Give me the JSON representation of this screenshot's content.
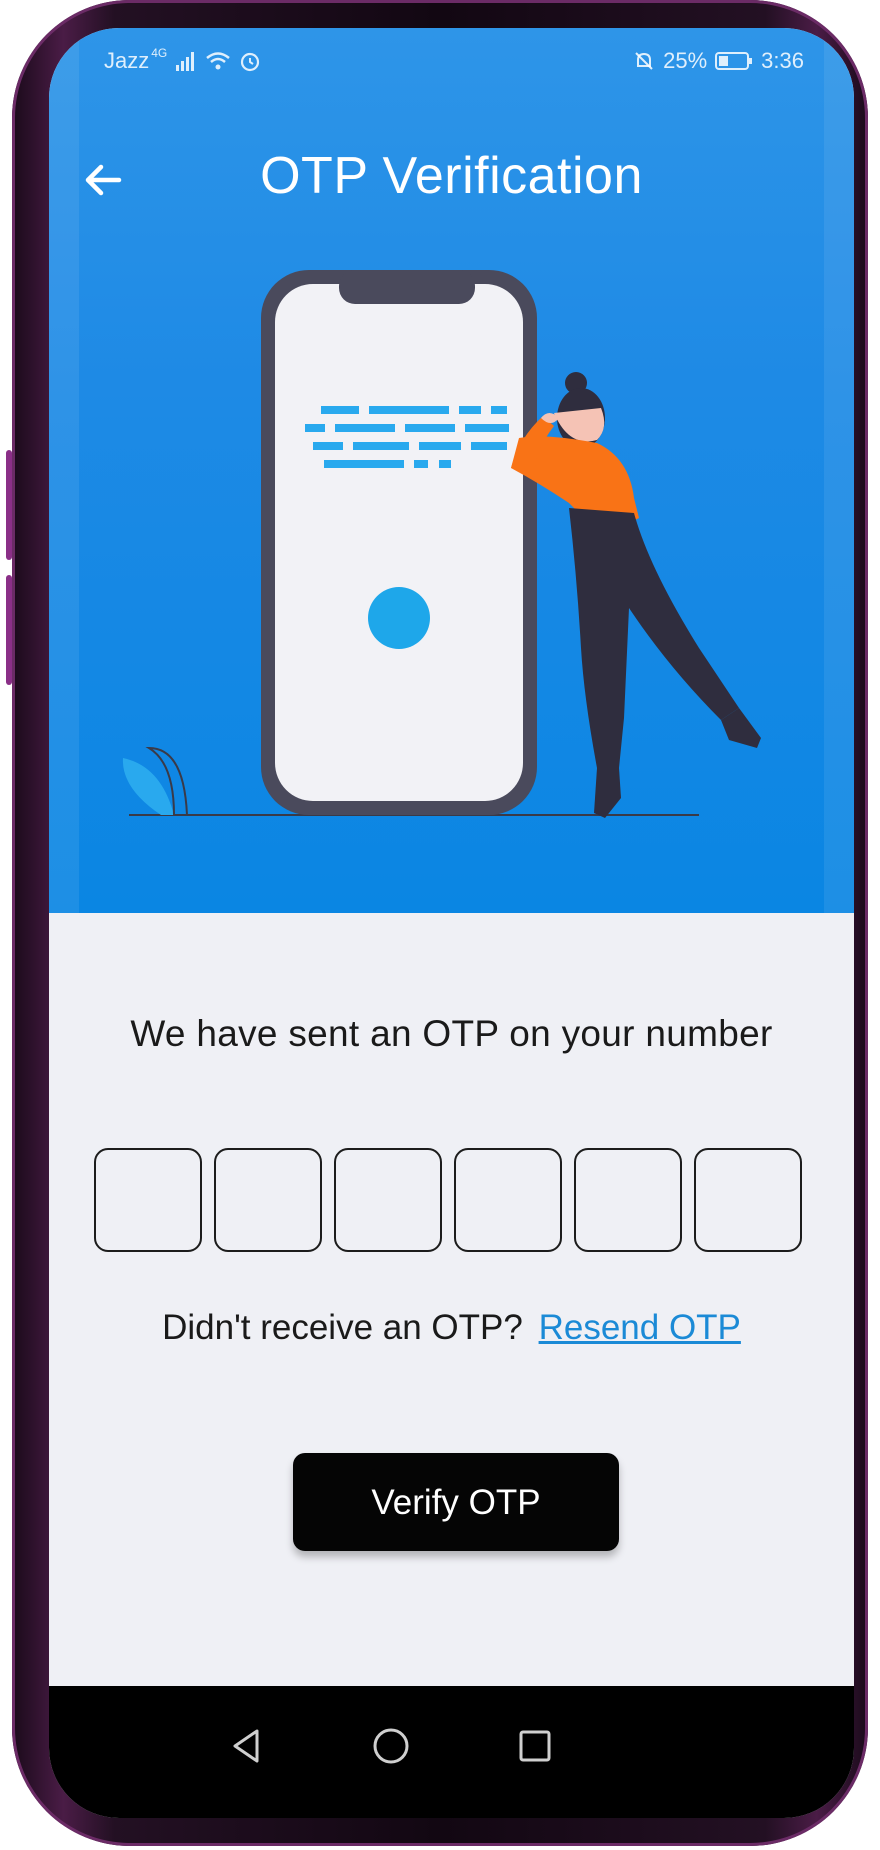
{
  "status_bar": {
    "carrier": "Jazz",
    "network": "4G",
    "battery": "25%",
    "time": "3:36"
  },
  "header": {
    "title": "OTP Verification",
    "back_icon": "arrow-left-icon"
  },
  "illustration": {
    "description_icon": "phone-with-person-illustration"
  },
  "content": {
    "message": "We have sent an OTP on your number",
    "otp_fields": [
      "",
      "",
      "",
      "",
      "",
      ""
    ],
    "resend_prompt": "Didn't receive an OTP?",
    "resend_link": "Resend OTP",
    "verify_button": "Verify OTP"
  },
  "colors": {
    "hero_blue": "#1e8ae5",
    "link_blue": "#1b8ad6",
    "button_black": "#050505",
    "background": "#eff0f5",
    "illustration_accent": "#f97316"
  },
  "nav_bar": {
    "back": "triangle-back-icon",
    "home": "circle-home-icon",
    "recents": "square-recents-icon"
  }
}
